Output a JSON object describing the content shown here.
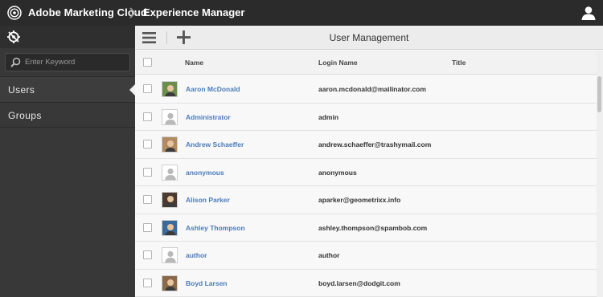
{
  "header": {
    "brand": "Adobe Marketing Cloud",
    "product": "Experience Manager",
    "logo_icon": "adobe-marketing-cloud-logo",
    "user_icon": "user-profile-icon"
  },
  "rail": {
    "nav_icon": "navigation-compass-icon",
    "search": {
      "placeholder": "Enter Keyword",
      "value": ""
    },
    "items": [
      {
        "label": "Users",
        "active": true
      },
      {
        "label": "Groups",
        "active": false
      }
    ]
  },
  "toolbar": {
    "menu_icon": "hamburger-menu-icon",
    "add_icon": "plus-icon",
    "title": "User Management"
  },
  "table": {
    "columns": {
      "name": "Name",
      "login": "Login Name",
      "title": "Title"
    },
    "rows": [
      {
        "name": "Aaron McDonald",
        "login": "aaron.mcdonald@mailinator.com",
        "title": "",
        "avatar": "photo"
      },
      {
        "name": "Administrator",
        "login": "admin",
        "title": "",
        "avatar": "placeholder"
      },
      {
        "name": "Andrew Schaeffer",
        "login": "andrew.schaeffer@trashymail.com",
        "title": "",
        "avatar": "photo"
      },
      {
        "name": "anonymous",
        "login": "anonymous",
        "title": "",
        "avatar": "placeholder"
      },
      {
        "name": "Alison Parker",
        "login": "aparker@geometrixx.info",
        "title": "",
        "avatar": "photo"
      },
      {
        "name": "Ashley Thompson",
        "login": "ashley.thompson@spambob.com",
        "title": "",
        "avatar": "photo"
      },
      {
        "name": "author",
        "login": "author",
        "title": "",
        "avatar": "placeholder"
      },
      {
        "name": "Boyd Larsen",
        "login": "boyd.larsen@dodgit.com",
        "title": "",
        "avatar": "photo"
      }
    ]
  },
  "colors": {
    "header_bg": "#2b2b2b",
    "rail_bg": "#383838",
    "link": "#4b7bbb"
  }
}
